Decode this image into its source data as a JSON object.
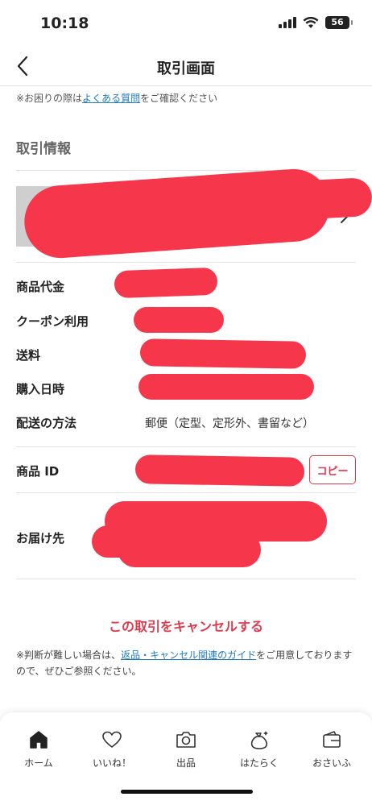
{
  "status_bar": {
    "time": "10:18",
    "battery": "56"
  },
  "header": {
    "title": "取引画面"
  },
  "help": {
    "prefix": "※お困りの際は",
    "link": "よくある質問",
    "suffix": "をご確認ください"
  },
  "section": {
    "title": "取引情報"
  },
  "info": {
    "price_label": "商品代金",
    "coupon_label": "クーポン利用",
    "shipping_label": "送料",
    "purchase_date_label": "購入日時",
    "delivery_method_label": "配送の方法",
    "delivery_method_value": "郵便（定型、定形外、書留など）",
    "item_id_label": "商品 ID",
    "copy_button": "コピー",
    "address_label": "お届け先"
  },
  "actions": {
    "cancel": "この取引をキャンセルする"
  },
  "guide": {
    "prefix": "※判断が難しい場合は、",
    "link": "返品・キャンセル関連のガイド",
    "suffix": "をご用意しておりますので、ぜひご参照ください。"
  },
  "tabs": [
    {
      "label": "ホーム",
      "icon": "home-icon"
    },
    {
      "label": "いいね！",
      "icon": "heart-icon"
    },
    {
      "label": "出品",
      "icon": "camera-icon"
    },
    {
      "label": "はたらく",
      "icon": "money-bag-icon"
    },
    {
      "label": "おさいふ",
      "icon": "wallet-icon"
    }
  ],
  "colors": {
    "accent": "#e03a4d",
    "link": "#1f7bc1",
    "redaction": "#f5364b"
  }
}
